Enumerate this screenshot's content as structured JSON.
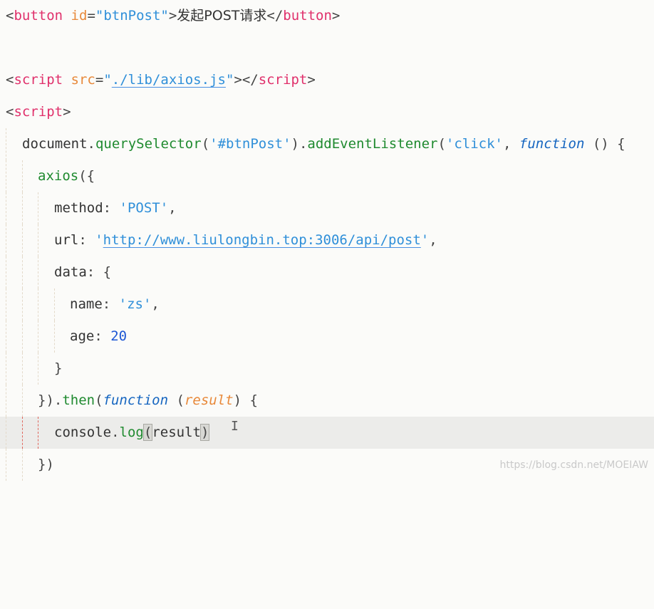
{
  "lines": {
    "l1": {
      "t1": "<",
      "t2": "button",
      "t3": " ",
      "t4": "id",
      "t5": "=",
      "t6": "\"btnPost\"",
      "t7": ">",
      "t8": "发起POST请求",
      "t9": "</",
      "t10": "button",
      "t11": ">"
    },
    "l3": {
      "t1": "<",
      "t2": "script",
      "t3": " ",
      "t4": "src",
      "t5": "=",
      "t6": "\"",
      "t7": "./lib/axios.js",
      "t8": "\"",
      "t9": "></",
      "t10": "script",
      "t11": ">"
    },
    "l4": {
      "t1": "<",
      "t2": "script",
      "t3": ">"
    },
    "l5": {
      "t1": "document",
      "t2": ".",
      "t3": "querySelector",
      "t4": "(",
      "t5": "'#btnPost'",
      "t6": ").",
      "t7": "addEventListener",
      "t8": "(",
      "t9": "'click'",
      "t10": ", ",
      "t11": "function",
      "t12": " () {"
    },
    "l6": {
      "t1": "axios",
      "t2": "({"
    },
    "l7": {
      "t1": "method",
      "t2": ": ",
      "t3": "'POST'",
      "t4": ","
    },
    "l8": {
      "t1": "url",
      "t2": ": ",
      "t3": "'",
      "t4": "http://www.liulongbin.top:3006/api/post",
      "t5": "'",
      "t6": ","
    },
    "l9": {
      "t1": "data",
      "t2": ": {"
    },
    "l10": {
      "t1": "name",
      "t2": ": ",
      "t3": "'zs'",
      "t4": ","
    },
    "l11": {
      "t1": "age",
      "t2": ": ",
      "t3": "20"
    },
    "l12": {
      "t1": "}"
    },
    "l13": {
      "t1": "}).",
      "t2": "then",
      "t3": "(",
      "t4": "function",
      "t5": " (",
      "t6": "result",
      "t7": ") {"
    },
    "l14": {
      "t1": "console",
      "t2": ".",
      "t3": "log",
      "t4": "(",
      "t5": "result",
      "t6": ")"
    },
    "l15": {
      "t1": "})"
    }
  },
  "cursor": {
    "glyph": "I"
  },
  "watermark": "https://blog.csdn.net/MOEIAW",
  "colors": {
    "tag": "#e0306b",
    "attr": "#e8893a",
    "string": "#2f8fd9",
    "number": "#1d57d4",
    "function": "#1f8a2f",
    "keyword": "#1565c0"
  }
}
